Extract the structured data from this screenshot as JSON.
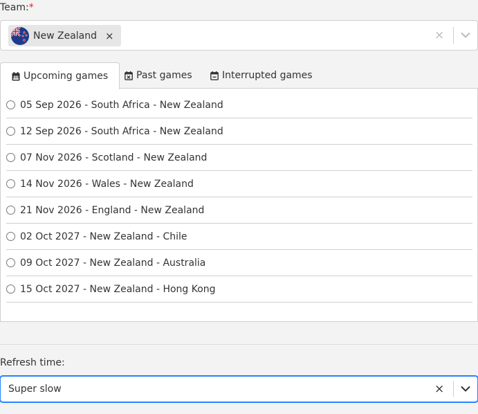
{
  "team": {
    "label": "Team:",
    "required_mark": "*",
    "selected_chip": "New Zealand",
    "chip_remove": "×",
    "clear": "×"
  },
  "tabs": [
    {
      "label": "Upcoming games",
      "icon": "calendar-icon",
      "active": true
    },
    {
      "label": "Past games",
      "icon": "calendar-x-icon",
      "active": false
    },
    {
      "label": "Interrupted games",
      "icon": "calendar-minus-icon",
      "active": false
    }
  ],
  "games": [
    "05 Sep 2026 - South Africa - New Zealand",
    "12 Sep 2026 - South Africa - New Zealand",
    "07 Nov 2026 - Scotland - New Zealand",
    "14 Nov 2026 - Wales - New Zealand",
    "21 Nov 2026 - England - New Zealand",
    "02 Oct 2027 - New Zealand - Chile",
    "09 Oct 2027 - New Zealand - Australia",
    "15 Oct 2027 - New Zealand - Hong Kong"
  ],
  "refresh": {
    "label": "Refresh time:",
    "value": "Super slow",
    "clear": "×"
  },
  "colors": {
    "focus": "#2684ff",
    "required": "#e0241b",
    "chip": "#e6e6e6"
  }
}
